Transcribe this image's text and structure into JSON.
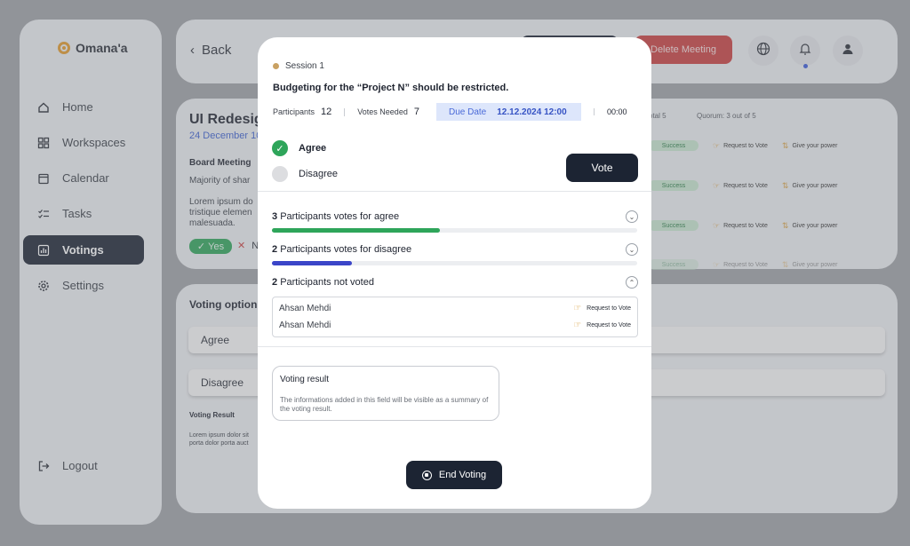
{
  "app": {
    "brand": "Omana'a"
  },
  "sidebar": {
    "items": [
      {
        "label": "Home",
        "icon": "home-icon"
      },
      {
        "label": "Workspaces",
        "icon": "grid-icon"
      },
      {
        "label": "Calendar",
        "icon": "calendar-icon"
      },
      {
        "label": "Tasks",
        "icon": "checklist-icon"
      },
      {
        "label": "Votings",
        "icon": "chart-icon",
        "active": true
      },
      {
        "label": "Settings",
        "icon": "gear-icon"
      }
    ],
    "logout": "Logout"
  },
  "topbar": {
    "back": "Back",
    "delete": "Delete Meeting"
  },
  "card1": {
    "title": "UI Redesig",
    "date": "24 December 10",
    "board": "Board Meeting",
    "majority": "Majority of shar",
    "lorem": "Lorem ipsum do tristique elemen malesuada.",
    "yes": "Yes",
    "no_short": "N",
    "total": "otal 5",
    "quorum": "Quorum: 3 out of 5",
    "rows": [
      {
        "status": "Success",
        "req": "Request to Vote",
        "give": "Give your power"
      },
      {
        "status": "Success",
        "req": "Request to Vote",
        "give": "Give your power"
      },
      {
        "status": "Success",
        "req": "Request to Vote",
        "give": "Give your power"
      },
      {
        "status": "Success",
        "req": "Request to Vote",
        "give": "Give your power"
      }
    ]
  },
  "card2": {
    "title": "Voting option",
    "options": [
      "Agree",
      "Disagree"
    ],
    "result_label": "Voting Result",
    "lorem": "Lorem ipsum dolor sit porta dolor porta auct"
  },
  "modal": {
    "session": "Session 1",
    "question": "Budgeting for the “Project N” should be restricted.",
    "participants_label": "Participants",
    "participants": "12",
    "votes_needed_label": "Votes Needed",
    "votes_needed": "7",
    "due_label": "Due Date",
    "due_value": "12.12.2024 12:00",
    "timer": "00:00",
    "choices": [
      {
        "label": "Agree",
        "selected": true
      },
      {
        "label": "Disagree",
        "selected": false
      }
    ],
    "vote_button": "Vote",
    "results": [
      {
        "count": "3",
        "text": "Participants votes for agree",
        "fraction": 0.46,
        "color": "#2ea55a",
        "expanded": false
      },
      {
        "count": "2",
        "text": "Participants votes for disagree",
        "fraction": 0.22,
        "color": "#3b45c8",
        "expanded": false
      },
      {
        "count": "2",
        "text": "Participants not voted",
        "expanded": true
      }
    ],
    "not_voted": [
      {
        "name": "Ahsan Mehdi",
        "action": "Request to Vote"
      },
      {
        "name": "Ahsan Mehdi",
        "action": "Request to Vote"
      }
    ],
    "voting_result": {
      "title": "Voting result",
      "description": "The informations added in this field will be visible as a summary of the voting result."
    },
    "end_button": "End Voting"
  }
}
